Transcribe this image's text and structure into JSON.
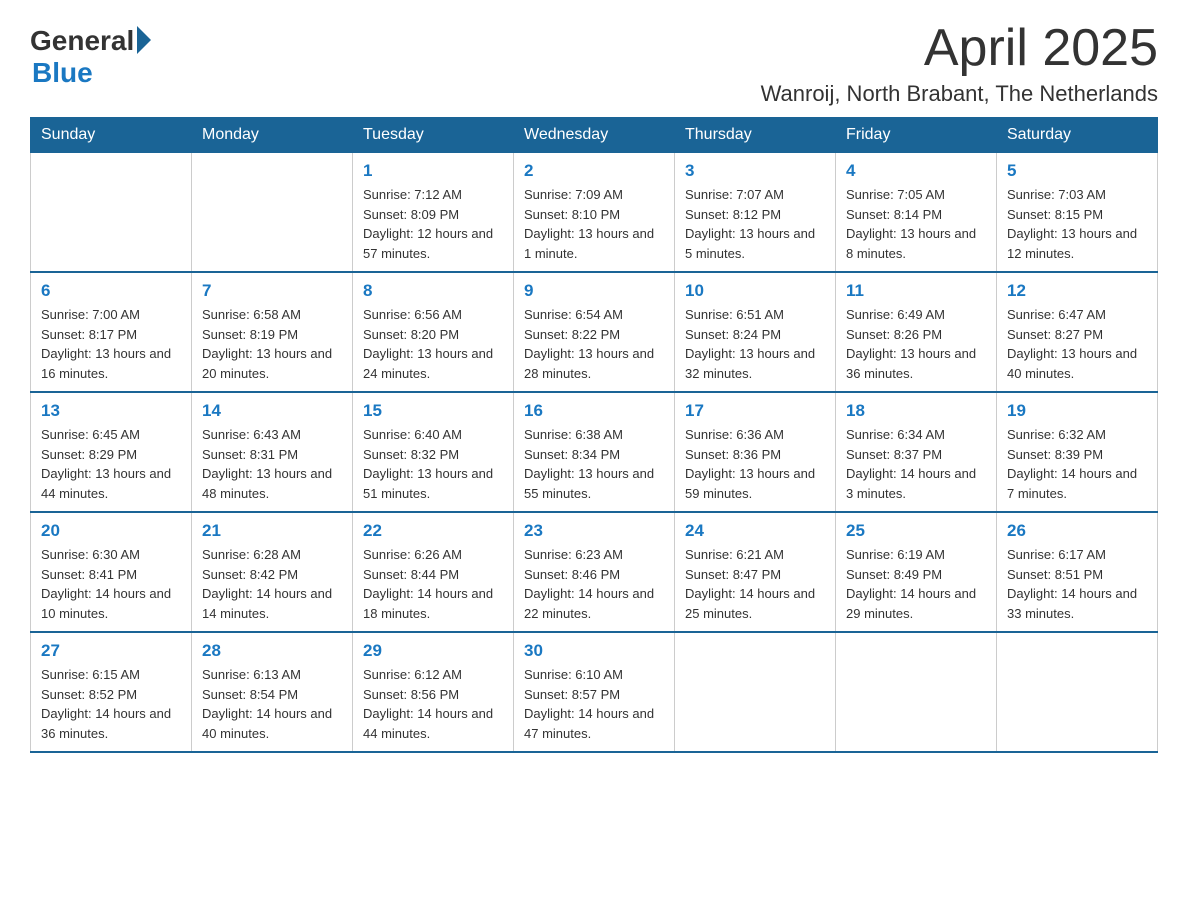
{
  "logo": {
    "general": "General",
    "blue": "Blue"
  },
  "title": "April 2025",
  "location": "Wanroij, North Brabant, The Netherlands",
  "days_of_week": [
    "Sunday",
    "Monday",
    "Tuesday",
    "Wednesday",
    "Thursday",
    "Friday",
    "Saturday"
  ],
  "weeks": [
    [
      {
        "day": "",
        "sunrise": "",
        "sunset": "",
        "daylight": ""
      },
      {
        "day": "",
        "sunrise": "",
        "sunset": "",
        "daylight": ""
      },
      {
        "day": "1",
        "sunrise": "Sunrise: 7:12 AM",
        "sunset": "Sunset: 8:09 PM",
        "daylight": "Daylight: 12 hours and 57 minutes."
      },
      {
        "day": "2",
        "sunrise": "Sunrise: 7:09 AM",
        "sunset": "Sunset: 8:10 PM",
        "daylight": "Daylight: 13 hours and 1 minute."
      },
      {
        "day": "3",
        "sunrise": "Sunrise: 7:07 AM",
        "sunset": "Sunset: 8:12 PM",
        "daylight": "Daylight: 13 hours and 5 minutes."
      },
      {
        "day": "4",
        "sunrise": "Sunrise: 7:05 AM",
        "sunset": "Sunset: 8:14 PM",
        "daylight": "Daylight: 13 hours and 8 minutes."
      },
      {
        "day": "5",
        "sunrise": "Sunrise: 7:03 AM",
        "sunset": "Sunset: 8:15 PM",
        "daylight": "Daylight: 13 hours and 12 minutes."
      }
    ],
    [
      {
        "day": "6",
        "sunrise": "Sunrise: 7:00 AM",
        "sunset": "Sunset: 8:17 PM",
        "daylight": "Daylight: 13 hours and 16 minutes."
      },
      {
        "day": "7",
        "sunrise": "Sunrise: 6:58 AM",
        "sunset": "Sunset: 8:19 PM",
        "daylight": "Daylight: 13 hours and 20 minutes."
      },
      {
        "day": "8",
        "sunrise": "Sunrise: 6:56 AM",
        "sunset": "Sunset: 8:20 PM",
        "daylight": "Daylight: 13 hours and 24 minutes."
      },
      {
        "day": "9",
        "sunrise": "Sunrise: 6:54 AM",
        "sunset": "Sunset: 8:22 PM",
        "daylight": "Daylight: 13 hours and 28 minutes."
      },
      {
        "day": "10",
        "sunrise": "Sunrise: 6:51 AM",
        "sunset": "Sunset: 8:24 PM",
        "daylight": "Daylight: 13 hours and 32 minutes."
      },
      {
        "day": "11",
        "sunrise": "Sunrise: 6:49 AM",
        "sunset": "Sunset: 8:26 PM",
        "daylight": "Daylight: 13 hours and 36 minutes."
      },
      {
        "day": "12",
        "sunrise": "Sunrise: 6:47 AM",
        "sunset": "Sunset: 8:27 PM",
        "daylight": "Daylight: 13 hours and 40 minutes."
      }
    ],
    [
      {
        "day": "13",
        "sunrise": "Sunrise: 6:45 AM",
        "sunset": "Sunset: 8:29 PM",
        "daylight": "Daylight: 13 hours and 44 minutes."
      },
      {
        "day": "14",
        "sunrise": "Sunrise: 6:43 AM",
        "sunset": "Sunset: 8:31 PM",
        "daylight": "Daylight: 13 hours and 48 minutes."
      },
      {
        "day": "15",
        "sunrise": "Sunrise: 6:40 AM",
        "sunset": "Sunset: 8:32 PM",
        "daylight": "Daylight: 13 hours and 51 minutes."
      },
      {
        "day": "16",
        "sunrise": "Sunrise: 6:38 AM",
        "sunset": "Sunset: 8:34 PM",
        "daylight": "Daylight: 13 hours and 55 minutes."
      },
      {
        "day": "17",
        "sunrise": "Sunrise: 6:36 AM",
        "sunset": "Sunset: 8:36 PM",
        "daylight": "Daylight: 13 hours and 59 minutes."
      },
      {
        "day": "18",
        "sunrise": "Sunrise: 6:34 AM",
        "sunset": "Sunset: 8:37 PM",
        "daylight": "Daylight: 14 hours and 3 minutes."
      },
      {
        "day": "19",
        "sunrise": "Sunrise: 6:32 AM",
        "sunset": "Sunset: 8:39 PM",
        "daylight": "Daylight: 14 hours and 7 minutes."
      }
    ],
    [
      {
        "day": "20",
        "sunrise": "Sunrise: 6:30 AM",
        "sunset": "Sunset: 8:41 PM",
        "daylight": "Daylight: 14 hours and 10 minutes."
      },
      {
        "day": "21",
        "sunrise": "Sunrise: 6:28 AM",
        "sunset": "Sunset: 8:42 PM",
        "daylight": "Daylight: 14 hours and 14 minutes."
      },
      {
        "day": "22",
        "sunrise": "Sunrise: 6:26 AM",
        "sunset": "Sunset: 8:44 PM",
        "daylight": "Daylight: 14 hours and 18 minutes."
      },
      {
        "day": "23",
        "sunrise": "Sunrise: 6:23 AM",
        "sunset": "Sunset: 8:46 PM",
        "daylight": "Daylight: 14 hours and 22 minutes."
      },
      {
        "day": "24",
        "sunrise": "Sunrise: 6:21 AM",
        "sunset": "Sunset: 8:47 PM",
        "daylight": "Daylight: 14 hours and 25 minutes."
      },
      {
        "day": "25",
        "sunrise": "Sunrise: 6:19 AM",
        "sunset": "Sunset: 8:49 PM",
        "daylight": "Daylight: 14 hours and 29 minutes."
      },
      {
        "day": "26",
        "sunrise": "Sunrise: 6:17 AM",
        "sunset": "Sunset: 8:51 PM",
        "daylight": "Daylight: 14 hours and 33 minutes."
      }
    ],
    [
      {
        "day": "27",
        "sunrise": "Sunrise: 6:15 AM",
        "sunset": "Sunset: 8:52 PM",
        "daylight": "Daylight: 14 hours and 36 minutes."
      },
      {
        "day": "28",
        "sunrise": "Sunrise: 6:13 AM",
        "sunset": "Sunset: 8:54 PM",
        "daylight": "Daylight: 14 hours and 40 minutes."
      },
      {
        "day": "29",
        "sunrise": "Sunrise: 6:12 AM",
        "sunset": "Sunset: 8:56 PM",
        "daylight": "Daylight: 14 hours and 44 minutes."
      },
      {
        "day": "30",
        "sunrise": "Sunrise: 6:10 AM",
        "sunset": "Sunset: 8:57 PM",
        "daylight": "Daylight: 14 hours and 47 minutes."
      },
      {
        "day": "",
        "sunrise": "",
        "sunset": "",
        "daylight": ""
      },
      {
        "day": "",
        "sunrise": "",
        "sunset": "",
        "daylight": ""
      },
      {
        "day": "",
        "sunrise": "",
        "sunset": "",
        "daylight": ""
      }
    ]
  ]
}
